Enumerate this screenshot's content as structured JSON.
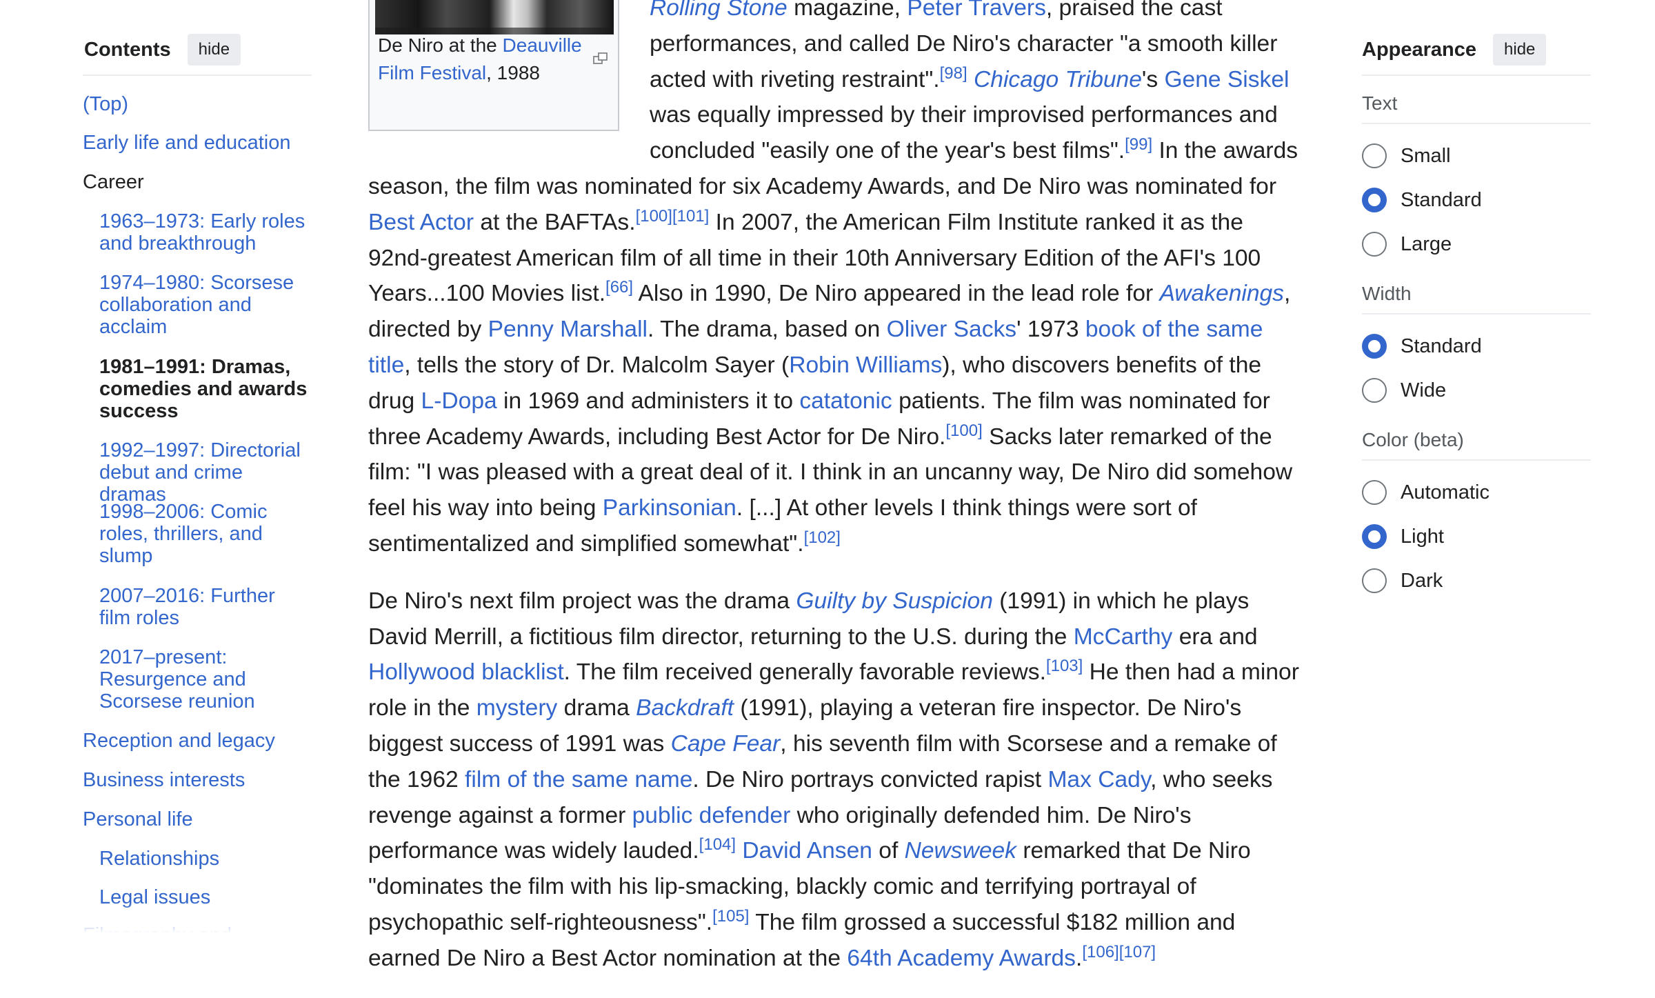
{
  "toc": {
    "title": "Contents",
    "hide_label": "hide",
    "items": [
      {
        "label": "(Top)"
      },
      {
        "label": "Early life and education"
      },
      {
        "label": "Career"
      },
      {
        "label": "1963–1973: Early roles and breakthrough"
      },
      {
        "label": "1974–1980: Scorsese collaboration and acclaim"
      },
      {
        "label": "1981–1991: Dramas, comedies and awards success"
      },
      {
        "label": "1992–1997: Directorial debut and crime dramas"
      },
      {
        "label": "1998–2006: Comic roles, thrillers, and slump"
      },
      {
        "label": "2007–2016: Further film roles"
      },
      {
        "label": "2017–present: Resurgence and Scorsese reunion"
      },
      {
        "label": "Reception and legacy"
      },
      {
        "label": "Business interests"
      },
      {
        "label": "Personal life"
      },
      {
        "label": "Relationships"
      },
      {
        "label": "Legal issues"
      },
      {
        "label": "Filmography and"
      }
    ]
  },
  "thumb": {
    "caption_prefix": "De Niro at the",
    "caption_link": "Deauville Film Festival",
    "caption_suffix": ", 1988"
  },
  "article": {
    "p1": [
      {
        "t": "Rolling Stone",
        "link": true,
        "i": true
      },
      {
        "t": " magazine, "
      },
      {
        "t": "Peter Travers",
        "link": true
      },
      {
        "t": ", praised the cast performances, and called De Niro's character \"a smooth killer acted with riveting restraint\"."
      },
      {
        "t": "[98]",
        "ref": true
      },
      {
        "t": " "
      },
      {
        "t": "Chicago Tribune",
        "link": true,
        "i": true
      },
      {
        "t": "'s "
      },
      {
        "t": "Gene Siskel",
        "link": true
      },
      {
        "t": " was equally impressed by their improvised performances and concluded \"easily one of the year's best films\"."
      },
      {
        "t": "[99]",
        "ref": true
      },
      {
        "t": " In the awards season, the film was nominated for six Academy Awards, and De Niro was nominated for "
      },
      {
        "t": "Best Actor",
        "link": true
      },
      {
        "t": " at the BAFTAs."
      },
      {
        "t": "[100]",
        "ref": true
      },
      {
        "t": "[101]",
        "ref": true
      },
      {
        "t": " In 2007, the American Film Institute ranked it as the 92nd-greatest American film of all time in their 10th Anniversary Edition of the AFI's 100 Years...100 Movies list."
      },
      {
        "t": "[66]",
        "ref": true
      },
      {
        "t": " Also in 1990, De Niro appeared in the lead role for "
      },
      {
        "t": "Awakenings",
        "link": true,
        "i": true
      },
      {
        "t": ", directed by "
      },
      {
        "t": "Penny Marshall",
        "link": true
      },
      {
        "t": ". The drama, based on "
      },
      {
        "t": "Oliver Sacks",
        "link": true
      },
      {
        "t": "' 1973 "
      },
      {
        "t": "book of the same title",
        "link": true
      },
      {
        "t": ", tells the story of Dr. Malcolm Sayer ("
      },
      {
        "t": "Robin Williams",
        "link": true
      },
      {
        "t": "), who discovers benefits of the drug "
      },
      {
        "t": "L-Dopa",
        "link": true
      },
      {
        "t": " in 1969 and administers it to "
      },
      {
        "t": "catatonic",
        "link": true
      },
      {
        "t": " patients. The film was nominated for three Academy Awards, including Best Actor for De Niro."
      },
      {
        "t": "[100]",
        "ref": true
      },
      {
        "t": " Sacks later remarked of the film: \"I was pleased with a great deal of it. I think in an uncanny way, De Niro did somehow feel his way into being "
      },
      {
        "t": "Parkinsonian",
        "link": true
      },
      {
        "t": ". [...] At other levels I think things were sort of sentimentalized and simplified somewhat\"."
      },
      {
        "t": "[102]",
        "ref": true
      }
    ],
    "p2": [
      {
        "t": "De Niro's next film project was the drama "
      },
      {
        "t": "Guilty by Suspicion",
        "link": true,
        "i": true
      },
      {
        "t": " (1991) in which he plays David Merrill, a fictitious film director, returning to the U.S. during the "
      },
      {
        "t": "McCarthy",
        "link": true
      },
      {
        "t": " era and "
      },
      {
        "t": "Hollywood blacklist",
        "link": true
      },
      {
        "t": ". The film received generally favorable reviews."
      },
      {
        "t": "[103]",
        "ref": true
      },
      {
        "t": " He then had a minor role in the "
      },
      {
        "t": "mystery",
        "link": true
      },
      {
        "t": " drama "
      },
      {
        "t": "Backdraft",
        "link": true,
        "i": true
      },
      {
        "t": " (1991), playing a veteran fire inspector. De Niro's biggest success of 1991 was "
      },
      {
        "t": "Cape Fear",
        "link": true,
        "i": true
      },
      {
        "t": ", his seventh film with Scorsese and a remake of the 1962 "
      },
      {
        "t": "film of the same name",
        "link": true
      },
      {
        "t": ". De Niro portrays convicted rapist "
      },
      {
        "t": "Max Cady",
        "link": true
      },
      {
        "t": ", who seeks revenge against a former "
      },
      {
        "t": "public defender",
        "link": true
      },
      {
        "t": " who originally defended him. De Niro's performance was widely lauded."
      },
      {
        "t": "[104]",
        "ref": true
      },
      {
        "t": " "
      },
      {
        "t": "David Ansen",
        "link": true
      },
      {
        "t": " of "
      },
      {
        "t": "Newsweek",
        "link": true,
        "i": true
      },
      {
        "t": " remarked that De Niro \"dominates the film with his lip-smacking, blackly comic and terrifying portrayal of psychopathic self-righteousness\"."
      },
      {
        "t": "[105]",
        "ref": true
      },
      {
        "t": " The film grossed a successful $182 million and earned De Niro a Best Actor nomination at the "
      },
      {
        "t": "64th Academy Awards",
        "link": true
      },
      {
        "t": "."
      },
      {
        "t": "[106]",
        "ref": true
      },
      {
        "t": "[107]",
        "ref": true
      }
    ]
  },
  "appearance": {
    "title": "Appearance",
    "hide_label": "hide",
    "text_label": "Text",
    "text_options": [
      {
        "label": "Small",
        "checked": false
      },
      {
        "label": "Standard",
        "checked": true
      },
      {
        "label": "Large",
        "checked": false
      }
    ],
    "width_label": "Width",
    "width_options": [
      {
        "label": "Standard",
        "checked": true
      },
      {
        "label": "Wide",
        "checked": false
      }
    ],
    "color_label": "Color (beta)",
    "color_options": [
      {
        "label": "Automatic",
        "checked": false
      },
      {
        "label": "Light",
        "checked": true
      },
      {
        "label": "Dark",
        "checked": false
      }
    ],
    "accent_color": "#3366cc"
  }
}
